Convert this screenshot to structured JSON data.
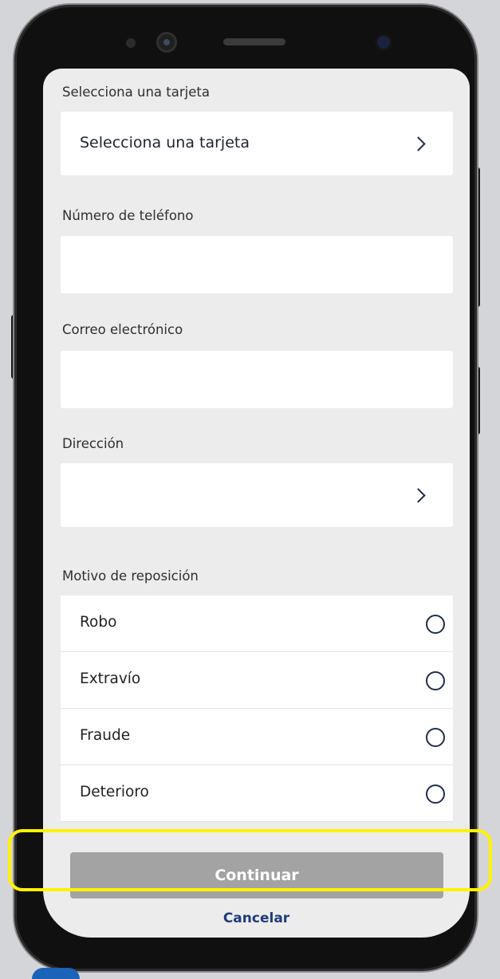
{
  "form": {
    "card": {
      "label": "Selecciona una tarjeta",
      "value": "Selecciona una tarjeta",
      "chevron": "chevron-right-icon"
    },
    "phone": {
      "label": "Número de teléfono",
      "value": ""
    },
    "email": {
      "label": "Correo electrónico",
      "value": ""
    },
    "address": {
      "label": "Dirección",
      "value": "",
      "chevron": "chevron-right-icon"
    },
    "reason": {
      "label": "Motivo de reposición",
      "options": [
        {
          "label": "Robo",
          "selected": false
        },
        {
          "label": "Extravío",
          "selected": false
        },
        {
          "label": "Fraude",
          "selected": false
        },
        {
          "label": "Deterioro",
          "selected": false
        }
      ]
    }
  },
  "actions": {
    "continue_label": "Continuar",
    "cancel_label": "Cancelar"
  },
  "colors": {
    "background": "#d4d5d9",
    "screen": "#ececec",
    "accent_dark": "#1f2d4d",
    "button_disabled": "#a3a3a3",
    "link": "#1f3b7a",
    "highlight": "#fff200"
  }
}
